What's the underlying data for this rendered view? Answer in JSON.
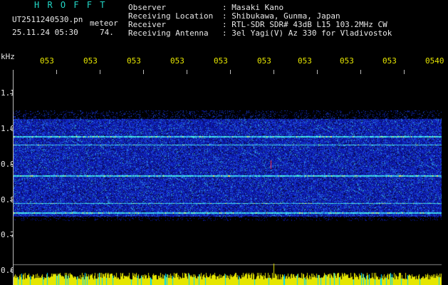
{
  "header": {
    "app_name": "H R O F F T",
    "file_name": "UT2511240530.pn",
    "file_type": "meteor",
    "date_time": "25.11.24 05:30",
    "count": "74.",
    "info": [
      {
        "label": "Observer",
        "value": ": Masaki Kano"
      },
      {
        "label": "Receiving Location",
        "value": ": Shibukawa, Gunma, Japan"
      },
      {
        "label": "Receiver",
        "value": ": RTL-SDR SDR# 43dB L15 103.2MHz CW"
      },
      {
        "label": "Receiving Antenna",
        "value": ": 3el Yagi(V) Az 330 for Vladivostok"
      }
    ]
  },
  "axis": {
    "y_unit": "kHz",
    "y_ticks": [
      "1.1",
      "1.0",
      "0.9",
      "0.8",
      "0.7",
      "0.6"
    ],
    "x_ticks": [
      "053",
      "053",
      "053",
      "053",
      "053",
      "053",
      "053",
      "053",
      "053",
      "0540"
    ]
  },
  "colors": {
    "header_text": "#e8e8e8",
    "app_name": "#22d8c8",
    "time_ticks": "#e6e600",
    "waterfall_bg": "#000010",
    "noise_floor": "#0a1a9a",
    "carrier_line": "#40ffe0",
    "audio_bar": "#e6e600",
    "audio_bar_alt": "#00d8ff"
  },
  "waterfall": {
    "band_top_khz": 1.0,
    "band_bottom_khz": 0.765,
    "carrier_lines_khz": [
      0.98,
      0.87,
      0.765,
      0.79,
      0.955
    ],
    "meteor_event_khz": 0.9,
    "meteor_event_minute_fraction": 0.6
  }
}
